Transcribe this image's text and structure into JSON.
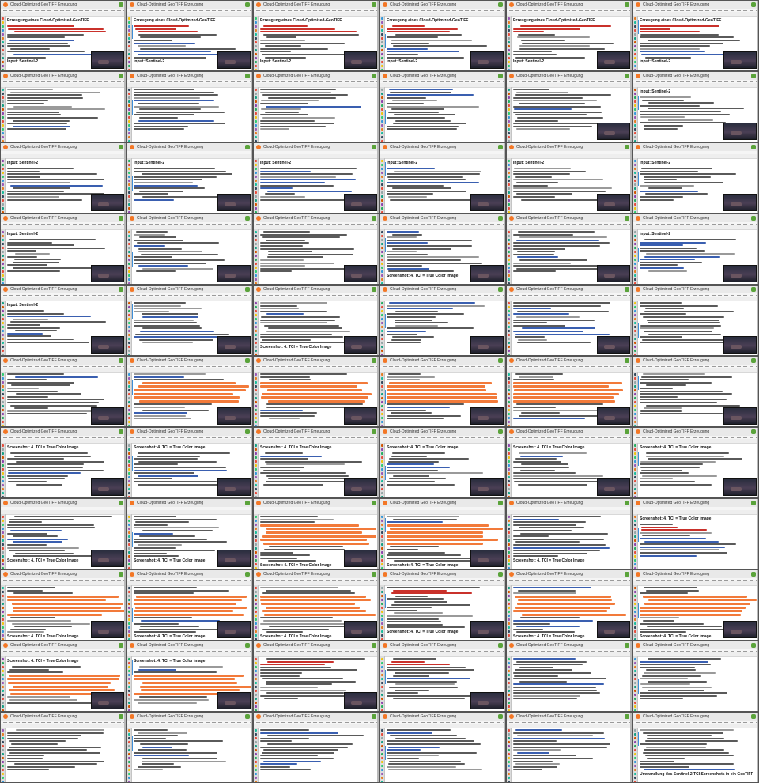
{
  "window": {
    "title": "Jupyter",
    "notebook_name": "Cloud-Optimized GeoTIFF Erzeugung",
    "tab_label": "Cloud-Optimized GeoTIFF_Erzeugung"
  },
  "headings": {
    "cog_title": "Erzeugung eines Cloud-Optimized-GeoTIFF",
    "input_sentinel2": "Input: Sentinel-2",
    "screenshot_truecolor": "Screenshot: 4. TCI = True Color Image",
    "conversion": "Umwandlung des Sentinel-2 TCI Screenshots in ein GeoTIFF"
  },
  "colors": {
    "accent": "#f37726",
    "error": "#c9312b",
    "highlight": "#f27a3a",
    "prompt": "#3f8fd8",
    "kernel": "#5aa33a"
  },
  "grid": {
    "columns": 6,
    "rows": 11
  },
  "tiles": [
    {
      "lines": "mixed",
      "heading": "cog_title",
      "sub": "input_sentinel2",
      "thumb": true
    },
    {
      "lines": "mixed",
      "heading": "cog_title",
      "sub": "input_sentinel2",
      "thumb": true
    },
    {
      "lines": "mixed",
      "heading": "cog_title",
      "sub": "input_sentinel2",
      "thumb": true
    },
    {
      "lines": "mixed",
      "heading": "cog_title",
      "sub": "input_sentinel2",
      "thumb": true
    },
    {
      "lines": "mixed",
      "heading": "cog_title",
      "sub": "input_sentinel2",
      "thumb": true
    },
    {
      "lines": "mixed",
      "heading": "cog_title",
      "sub": "input_sentinel2",
      "thumb": true
    },
    {
      "lines": "code",
      "heading": "",
      "sub": "",
      "thumb": false
    },
    {
      "lines": "code",
      "heading": "",
      "sub": "",
      "thumb": false
    },
    {
      "lines": "code",
      "heading": "",
      "sub": "",
      "thumb": false
    },
    {
      "lines": "code",
      "heading": "",
      "sub": "",
      "thumb": false
    },
    {
      "lines": "code",
      "heading": "",
      "sub": "",
      "thumb": true
    },
    {
      "lines": "code",
      "heading": "input_sentinel2",
      "sub": "",
      "thumb": true
    },
    {
      "lines": "code",
      "heading": "input_sentinel2",
      "sub": "",
      "thumb": true
    },
    {
      "lines": "code",
      "heading": "input_sentinel2",
      "sub": "",
      "thumb": true
    },
    {
      "lines": "code",
      "heading": "input_sentinel2",
      "sub": "",
      "thumb": true
    },
    {
      "lines": "code",
      "heading": "input_sentinel2",
      "sub": "",
      "thumb": true
    },
    {
      "lines": "code",
      "heading": "input_sentinel2",
      "sub": "",
      "thumb": true
    },
    {
      "lines": "code",
      "heading": "input_sentinel2",
      "sub": "",
      "thumb": true
    },
    {
      "lines": "code",
      "heading": "input_sentinel2",
      "sub": "",
      "thumb": true
    },
    {
      "lines": "code",
      "heading": "",
      "sub": "",
      "thumb": true
    },
    {
      "lines": "code",
      "heading": "",
      "sub": "",
      "thumb": true
    },
    {
      "lines": "code",
      "heading": "",
      "sub": "screenshot_truecolor",
      "thumb": true
    },
    {
      "lines": "code",
      "heading": "",
      "sub": "",
      "thumb": true
    },
    {
      "lines": "code",
      "heading": "input_sentinel2",
      "sub": "",
      "thumb": true
    },
    {
      "lines": "code",
      "heading": "input_sentinel2",
      "sub": "",
      "thumb": true
    },
    {
      "lines": "code",
      "heading": "",
      "sub": "",
      "thumb": true
    },
    {
      "lines": "code",
      "heading": "",
      "sub": "screenshot_truecolor",
      "thumb": true
    },
    {
      "lines": "code",
      "heading": "",
      "sub": "",
      "thumb": true
    },
    {
      "lines": "code",
      "heading": "",
      "sub": "",
      "thumb": true
    },
    {
      "lines": "code",
      "heading": "",
      "sub": "",
      "thumb": true
    },
    {
      "lines": "code",
      "heading": "",
      "sub": "",
      "thumb": true
    },
    {
      "lines": "orange",
      "heading": "",
      "sub": "",
      "thumb": true
    },
    {
      "lines": "orange",
      "heading": "",
      "sub": "",
      "thumb": true
    },
    {
      "lines": "orange",
      "heading": "",
      "sub": "",
      "thumb": true
    },
    {
      "lines": "orange",
      "heading": "",
      "sub": "",
      "thumb": true
    },
    {
      "lines": "code",
      "heading": "",
      "sub": "",
      "thumb": true
    },
    {
      "lines": "code",
      "heading": "screenshot_truecolor",
      "sub": "",
      "thumb": true
    },
    {
      "lines": "code",
      "heading": "screenshot_truecolor",
      "sub": "",
      "thumb": true
    },
    {
      "lines": "code",
      "heading": "screenshot_truecolor",
      "sub": "",
      "thumb": true
    },
    {
      "lines": "code",
      "heading": "screenshot_truecolor",
      "sub": "",
      "thumb": true
    },
    {
      "lines": "code",
      "heading": "screenshot_truecolor",
      "sub": "",
      "thumb": true
    },
    {
      "lines": "code",
      "heading": "screenshot_truecolor",
      "sub": "",
      "thumb": true
    },
    {
      "lines": "code",
      "heading": "",
      "sub": "screenshot_truecolor",
      "thumb": true
    },
    {
      "lines": "code",
      "heading": "",
      "sub": "screenshot_truecolor",
      "thumb": true
    },
    {
      "lines": "orange",
      "heading": "",
      "sub": "screenshot_truecolor",
      "thumb": true
    },
    {
      "lines": "orange",
      "heading": "",
      "sub": "screenshot_truecolor",
      "thumb": true
    },
    {
      "lines": "code",
      "heading": "",
      "sub": "screenshot_truecolor",
      "thumb": false
    },
    {
      "lines": "red",
      "heading": "screenshot_truecolor",
      "sub": "",
      "thumb": false
    },
    {
      "lines": "orange",
      "heading": "",
      "sub": "screenshot_truecolor",
      "thumb": true
    },
    {
      "lines": "orange",
      "heading": "",
      "sub": "screenshot_truecolor",
      "thumb": true
    },
    {
      "lines": "orange",
      "heading": "",
      "sub": "screenshot_truecolor",
      "thumb": true
    },
    {
      "lines": "red",
      "heading": "",
      "sub": "screenshot_truecolor",
      "thumb": true
    },
    {
      "lines": "orange",
      "heading": "",
      "sub": "screenshot_truecolor",
      "thumb": true
    },
    {
      "lines": "orange",
      "heading": "",
      "sub": "screenshot_truecolor",
      "thumb": true
    },
    {
      "lines": "orange",
      "heading": "screenshot_truecolor",
      "sub": "",
      "thumb": true
    },
    {
      "lines": "orange",
      "heading": "screenshot_truecolor",
      "sub": "",
      "thumb": true
    },
    {
      "lines": "red",
      "heading": "",
      "sub": "",
      "thumb": true
    },
    {
      "lines": "red",
      "heading": "",
      "sub": "",
      "thumb": true
    },
    {
      "lines": "code",
      "heading": "",
      "sub": "",
      "thumb": false
    },
    {
      "lines": "code",
      "heading": "",
      "sub": "",
      "thumb": false
    },
    {
      "lines": "code",
      "heading": "",
      "sub": "",
      "thumb": false
    },
    {
      "lines": "code",
      "heading": "",
      "sub": "",
      "thumb": false
    },
    {
      "lines": "code",
      "heading": "",
      "sub": "",
      "thumb": false
    },
    {
      "lines": "code",
      "heading": "",
      "sub": "",
      "thumb": false
    },
    {
      "lines": "code",
      "heading": "",
      "sub": "",
      "thumb": false
    },
    {
      "lines": "code",
      "heading": "",
      "sub": "conversion",
      "thumb": false
    }
  ]
}
